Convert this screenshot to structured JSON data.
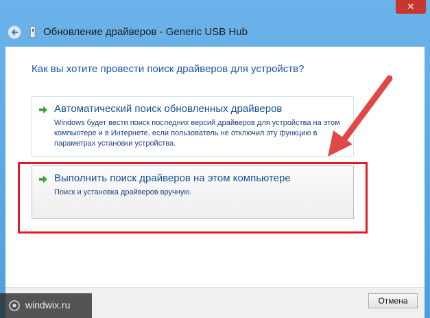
{
  "window": {
    "title": "Обновление драйверов - Generic USB Hub",
    "close_label": "✕"
  },
  "heading": "Как вы хотите провести поиск драйверов для устройств?",
  "options": [
    {
      "title": "Автоматический поиск обновленных драйверов",
      "description": "Windows будет вести поиск последних версий драйверов для устройства на этом компьютере и в Интернете, если пользователь не отключил эту функцию в параметрах установки устройства."
    },
    {
      "title": "Выполнить поиск драйверов на этом компьютере",
      "description": "Поиск и установка драйверов вручную."
    }
  ],
  "footer": {
    "cancel_label": "Отмена"
  },
  "watermark": {
    "text": "windwix.ru"
  },
  "colors": {
    "accent_text": "#1c56a8",
    "highlight": "#e11b22",
    "annotation_arrow": "#e04848",
    "option_arrow": "#3aa73a"
  },
  "icons": {
    "back": "back-arrow-icon",
    "device": "usb-device-icon",
    "option": "green-arrow-icon"
  }
}
